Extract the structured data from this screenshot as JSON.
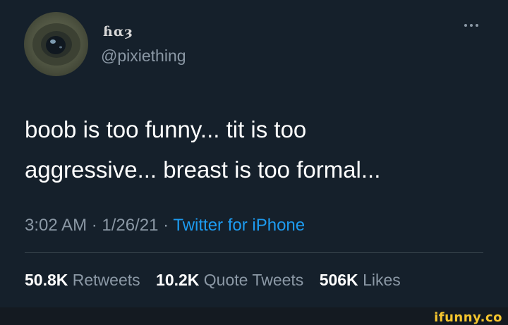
{
  "author": {
    "display_name": "ɦαȝ",
    "handle": "@pixiething",
    "avatar_icon": "avatar-eye-icon"
  },
  "menu": {
    "more_icon": "more-horizontal-icon"
  },
  "tweet": {
    "text_lines": [
      "boob is too funny... tit is too",
      "aggressive... breast is too formal..."
    ],
    "time": "3:02 AM",
    "separator": " · ",
    "date": "1/26/21",
    "source": "Twitter for iPhone"
  },
  "stats": {
    "retweets_count": "50.8K",
    "retweets_label": "Retweets",
    "quotes_count": "10.2K",
    "quotes_label": "Quote Tweets",
    "likes_count": "506K",
    "likes_label": "Likes"
  },
  "watermark": {
    "text": "ifunny.co"
  },
  "colors": {
    "background": "#15202b",
    "text": "#ffffff",
    "secondary": "#8b98a5",
    "link": "#1d9bf0",
    "watermark": "#f5c52e"
  }
}
